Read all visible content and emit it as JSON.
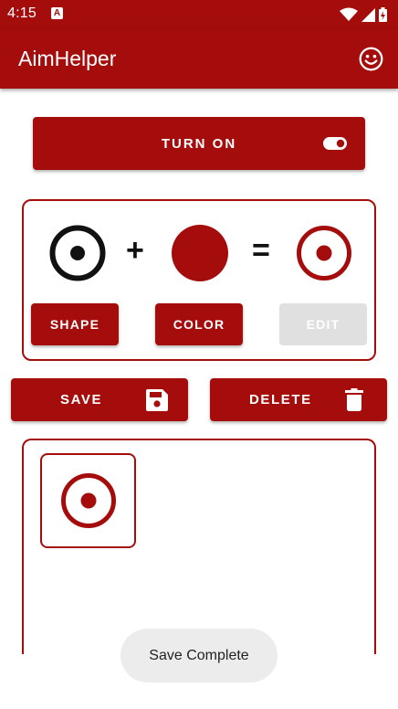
{
  "status_bar": {
    "time": "4:15",
    "notification_glyph": "A",
    "icons": [
      "wifi-icon",
      "cell-signal-icon",
      "battery-icon"
    ]
  },
  "app_bar": {
    "title": "AimHelper",
    "action_icon": "smiley-icon"
  },
  "toggle_button": {
    "label": "TURN ON",
    "icon": "toggle-icon"
  },
  "mixer": {
    "plus": "+",
    "equals": "=",
    "shape_button": "SHAPE",
    "color_button": "COLOR",
    "edit_button": "EDIT",
    "edit_enabled": false
  },
  "actions": {
    "save_label": "SAVE",
    "save_icon": "floppy-disk-icon",
    "delete_label": "DELETE",
    "delete_icon": "trash-icon"
  },
  "toast": {
    "message": "Save Complete"
  },
  "colors": {
    "brand": "#a50d0d",
    "disabled": "#e0e0e0",
    "toast_bg": "#ececec",
    "shape_preview": "#111111"
  }
}
